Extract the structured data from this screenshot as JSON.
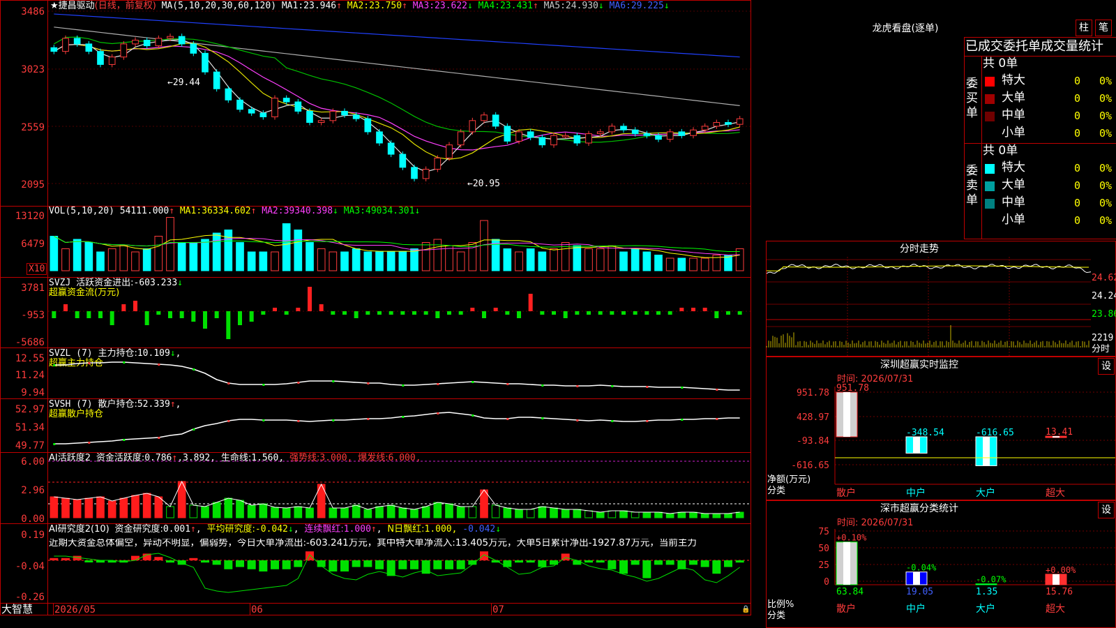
{
  "stock": {
    "name": "捷昌驱动",
    "period": "(日线，前复权)"
  },
  "price_panel": {
    "ma_header": "MA(5,10,20,30,60,120)",
    "ma": [
      {
        "label": "MA1:",
        "value": "23.946",
        "arrow": "↑",
        "color": "#ffffff"
      },
      {
        "label": "MA2:",
        "value": "23.750",
        "arrow": "↑",
        "color": "#ffff00"
      },
      {
        "label": "MA3:",
        "value": "23.622",
        "arrow": "↓",
        "color": "#ff40ff"
      },
      {
        "label": "MA4:",
        "value": "23.431",
        "arrow": "↑",
        "color": "#00ff00"
      },
      {
        "label": "MA5:",
        "value": "24.930",
        "arrow": "↓",
        "color": "#c8c8c8"
      },
      {
        "label": "MA6:",
        "value": "29.225",
        "arrow": "↓",
        "color": "#4060ff"
      }
    ],
    "y_labels": [
      "3486",
      "3023",
      "2559",
      "2095"
    ],
    "high_label": "29.44",
    "low_label": "←20.95",
    "high_prefix": "←"
  },
  "vol_panel": {
    "header": "VOL(5,10,20)",
    "value": "54111.000",
    "value_arrow": "↑",
    "ma": [
      {
        "label": "MA1:",
        "value": "36334.602",
        "arrow": "↑",
        "color": "#ffff00"
      },
      {
        "label": "MA2:",
        "value": "39340.398",
        "arrow": "↓",
        "color": "#ff40ff"
      },
      {
        "label": "MA3:",
        "value": "49034.301",
        "arrow": "↓",
        "color": "#00ff00"
      }
    ],
    "y_labels": [
      "13120",
      "6479"
    ],
    "unit": "X10"
  },
  "svzj_panel": {
    "header": "SVZJ",
    "label": "活跃资金进出:",
    "value": "-603.233",
    "arrow": "↓",
    "sub": "超赢资金流(万元)",
    "y_labels": [
      "3781",
      "-953",
      "-5686"
    ]
  },
  "svzl_panel": {
    "header": "SVZL (7)",
    "label": "主力持仓:",
    "value": "10.109",
    "arrow": "↓",
    "sub": "超赢主力持仓",
    "y_labels": [
      "12.55",
      "11.24",
      "9.94"
    ]
  },
  "svsh_panel": {
    "header": "SVSH (7)",
    "label": "散户持仓:",
    "value": "52.339",
    "arrow": "↑",
    "sub": "超赢散户持仓",
    "y_labels": [
      "52.97",
      "51.34",
      "49.77"
    ]
  },
  "ai_active_panel": {
    "header": "AI活跃度2",
    "label1": "资金活跃度:",
    "value1": "0.786",
    "arrow1": "↑",
    "value2": "3.892",
    "label3": "生命线:",
    "value3": "1.560",
    "label4": "强势线:",
    "value4": "3.000",
    "label5": "爆发线:",
    "value5": "6.000",
    "y_labels": [
      "6.00",
      "2.96",
      "0.00"
    ]
  },
  "ai_research_panel": {
    "header": "AI研究度2(10)",
    "label1": "资金研究度:",
    "value1": "0.001",
    "arrow1": "↑",
    "label2": "平均研究度:",
    "value2": "-0.042",
    "arrow2": "↓",
    "label3": "连续飘红:",
    "value3": "1.000",
    "arrow3": "↑",
    "label4": "N日飘红:",
    "value4": "1.000",
    "value5": "-0.042",
    "arrow5": "↓",
    "note": "近期大资金总体偏空，异动不明显，偏弱势，今日大单净流出:-603.241万元，其中特大单净流入:13.405万元，大单5日累计净出-1927.87万元，当前主力",
    "y_labels": [
      "0.19",
      "-0.04",
      "-0.26"
    ]
  },
  "x_axis": {
    "labels": [
      "2026/05",
      "06",
      "07"
    ],
    "brand": "大智慧"
  },
  "longhu": {
    "title": "龙虎看盘(逐单)",
    "btn_bar": "柱",
    "btn_pen": "笔",
    "subtitle": "已成交委托单成交量统计",
    "buy": {
      "side_label": "委买单",
      "total": "共 0单",
      "rows": [
        {
          "color": "#ff0000",
          "label": "特大",
          "count": "0",
          "pct": "0%"
        },
        {
          "color": "#a00000",
          "label": "大单",
          "count": "0",
          "pct": "0%"
        },
        {
          "color": "#700000",
          "label": "中单",
          "count": "0",
          "pct": "0%"
        },
        {
          "color": "#000000",
          "label": "小单",
          "count": "0",
          "pct": "0%"
        }
      ]
    },
    "sell": {
      "side_label": "委卖单",
      "total": "共 0单",
      "rows": [
        {
          "color": "#00ffff",
          "label": "特大",
          "count": "0",
          "pct": "0%"
        },
        {
          "color": "#00a0a0",
          "label": "大单",
          "count": "0",
          "pct": "0%"
        },
        {
          "color": "#008080",
          "label": "中单",
          "count": "0",
          "pct": "0%"
        },
        {
          "color": "#000000",
          "label": "小单",
          "count": "0",
          "pct": "0%"
        }
      ]
    }
  },
  "intraday": {
    "title": "分时走势",
    "y_labels": [
      "24.62",
      "24.24",
      "23.86"
    ],
    "vol_label": "2219",
    "vol_unit": "分时"
  },
  "monitor": {
    "title": "深圳超赢实时监控",
    "btn": "设",
    "time": "时间: 2026/07/31",
    "y_labels": [
      "951.78",
      "428.97",
      "-93.84",
      "-616.65"
    ],
    "unit": "净额(万元)",
    "cat_label": "分类",
    "bars": [
      {
        "name": "散户",
        "value": "951.78"
      },
      {
        "name": "中户",
        "value": "-348.54"
      },
      {
        "name": "大户",
        "value": "-616.65"
      },
      {
        "name": "超大",
        "value": "13.41"
      }
    ]
  },
  "classify": {
    "title": "深市超赢分类统计",
    "btn": "设",
    "time": "时间: 2026/07/31",
    "y_labels": [
      "75",
      "50",
      "25",
      "0"
    ],
    "unit": "比例%",
    "cat_label": "分类",
    "bars": [
      {
        "name": "散户",
        "pct": "63.84",
        "change": "+0.10%"
      },
      {
        "name": "中户",
        "pct": "19.05",
        "change": "-0.04%"
      },
      {
        "name": "大户",
        "pct": "1.35",
        "change": "-0.07%"
      },
      {
        "name": "超大",
        "pct": "15.76",
        "change": "+0.00%"
      }
    ]
  },
  "chart_data": {
    "type": "candlestick",
    "candles_close": [
      27.9,
      28.6,
      28.3,
      27.9,
      27.2,
      27.6,
      28.3,
      28.5,
      28.2,
      28.6,
      28.7,
      28.3,
      27.8,
      26.8,
      25.9,
      25.3,
      24.8,
      24.6,
      24.4,
      25.4,
      25.2,
      24.7,
      24.1,
      24.2,
      24.7,
      24.5,
      24.3,
      23.6,
      23.0,
      22.4,
      21.7,
      21.1,
      21.6,
      22.2,
      22.9,
      23.6,
      24.2,
      24.5,
      23.9,
      23.1,
      23.6,
      23.3,
      22.9,
      23.4,
      23.4,
      23.0,
      23.5,
      23.6,
      23.9,
      23.7,
      23.5,
      23.4,
      23.2,
      23.6,
      23.4,
      23.7,
      23.9,
      24.1,
      24.0,
      24.3
    ]
  }
}
